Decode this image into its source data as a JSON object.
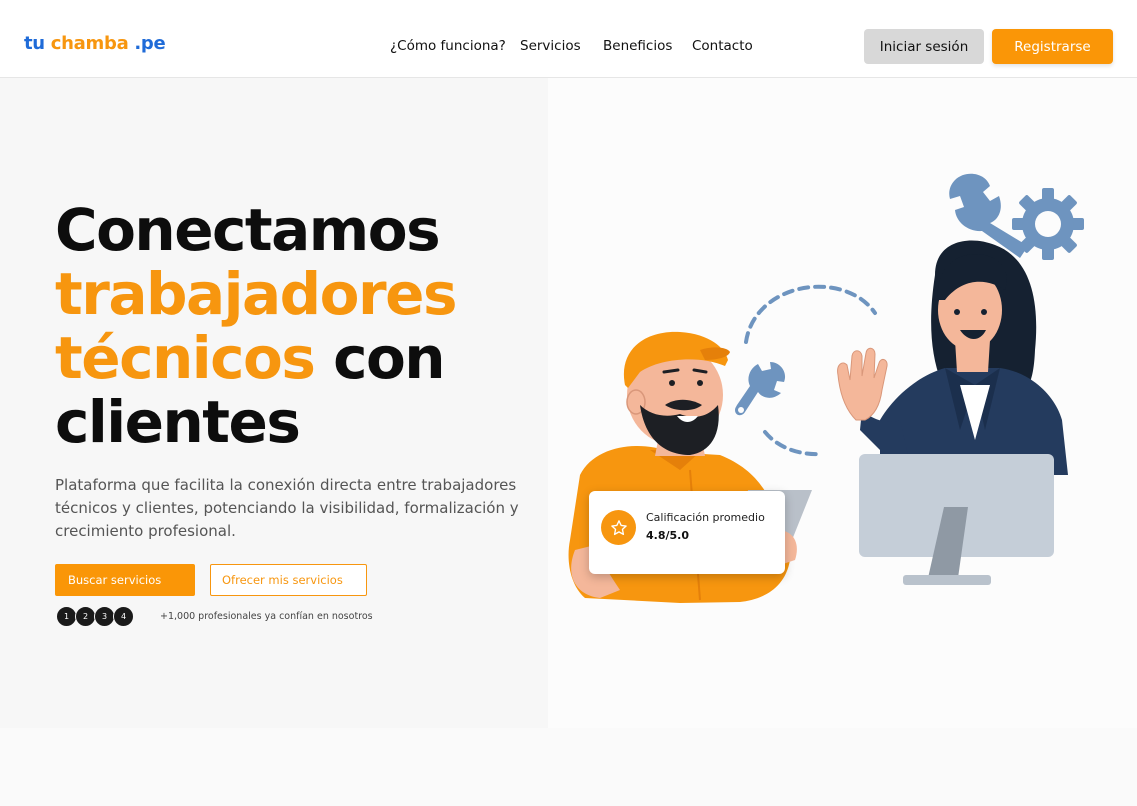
{
  "header": {
    "logo": {
      "part1": "tu",
      "part2": "chamba",
      "part3": ".pe"
    },
    "nav": [
      "¿Cómo funciona?",
      "Servicios",
      "Beneficios",
      "Contacto"
    ],
    "login_label": "Iniciar sesión",
    "register_label": "Registrarse"
  },
  "hero": {
    "headline": {
      "line1": "Conectamos",
      "line2": "trabajadores",
      "line3_orange": "técnicos",
      "line3_dark": " con",
      "line4": "clientes"
    },
    "subtitle": "Plataforma que facilita la conexión directa entre trabajadores técnicos y clientes, potenciando la visibilidad, formalización y crecimiento profesional.",
    "primary_button": "Buscar servicios",
    "secondary_button": "Ofrecer mis servicios",
    "avatars": [
      "1",
      "2",
      "3",
      "4"
    ],
    "social_proof": "+1,000 profesionales ya confían en nosotros"
  },
  "rating_card": {
    "icon": "star-icon",
    "label": "Calificación promedio",
    "value": "4.8/5.0"
  },
  "colors": {
    "brand_blue": "#1f6bd8",
    "brand_orange": "#f7960f",
    "tool_blue": "#6e94bf",
    "suit_navy": "#243b5e"
  },
  "icons": [
    "wrench-icon",
    "gear-icon",
    "star-icon"
  ]
}
